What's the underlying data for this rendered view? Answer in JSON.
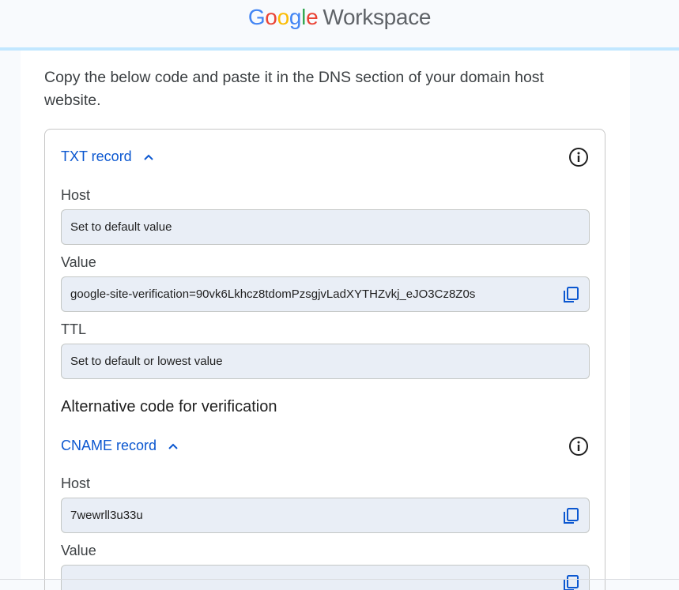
{
  "header": {
    "logo_google": [
      "G",
      "o",
      "o",
      "g",
      "l",
      "e"
    ],
    "logo_product": "Workspace"
  },
  "intro_text": "Copy the below code and paste it in the DNS section of your domain host website.",
  "txt_record": {
    "title": "TXT record",
    "host_label": "Host",
    "host_value": "Set to default value",
    "value_label": "Value",
    "value_value": "google-site-verification=90vk6Lkhcz8tdomPzsgjvLadXYTHZvkj_eJO3Cz8Z0s",
    "ttl_label": "TTL",
    "ttl_value": "Set to default or lowest value"
  },
  "alternative_title": "Alternative code for verification",
  "cname_record": {
    "title": "CNAME record",
    "host_label": "Host",
    "host_value": "7wewrll3u33u",
    "value_label": "Value",
    "value_value": ""
  },
  "colors": {
    "link_blue": "#0b57d0",
    "field_bg": "#e9eef6",
    "header_divider": "#c2e7ff"
  },
  "icons": [
    "chevron-up-icon",
    "info-icon",
    "copy-icon"
  ]
}
